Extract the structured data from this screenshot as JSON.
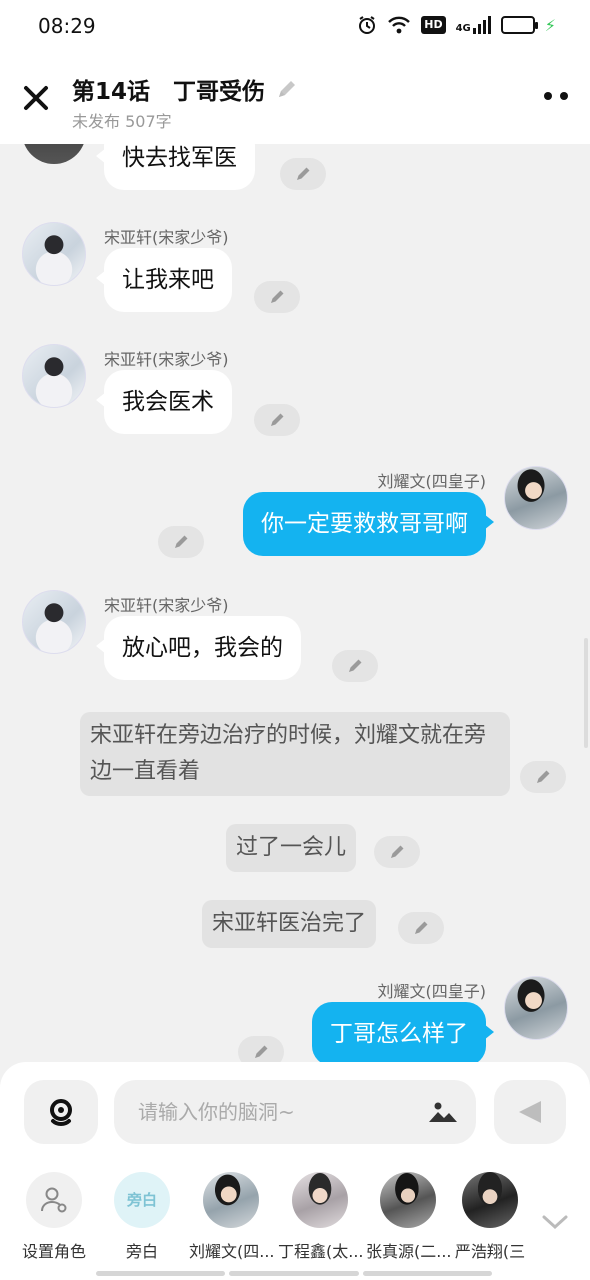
{
  "status_bar": {
    "time": "08:29",
    "network": "4G",
    "hd": "HD",
    "battery_level": 0.9,
    "battery_color": "#35c759"
  },
  "header": {
    "title": "第14话　丁哥受伤",
    "subtitle": "未发布 507字",
    "close_icon": "close-icon",
    "more_icon": "more-icon"
  },
  "messages": [
    {
      "type": "left",
      "sender": "",
      "text": "快去找军医"
    },
    {
      "type": "left",
      "sender": "宋亚轩(宋家少爷)",
      "text": "让我来吧"
    },
    {
      "type": "left",
      "sender": "宋亚轩(宋家少爷)",
      "text": "我会医术"
    },
    {
      "type": "right",
      "sender": "刘耀文(四皇子)",
      "text": "你一定要救救哥哥啊"
    },
    {
      "type": "left",
      "sender": "宋亚轩(宋家少爷)",
      "text": "放心吧，我会的"
    },
    {
      "type": "narration",
      "text": "宋亚轩在旁边治疗的时候，刘耀文就在旁边一直看着"
    },
    {
      "type": "narration",
      "text": "过了一会儿"
    },
    {
      "type": "narration",
      "text": "宋亚轩医治完了"
    },
    {
      "type": "right",
      "sender": "刘耀文(四皇子)",
      "text": "丁哥怎么样了"
    }
  ],
  "input": {
    "placeholder": "请输入你的脑洞~",
    "value": ""
  },
  "roles": [
    {
      "label": "设置角色",
      "kind": "setting"
    },
    {
      "label": "旁白",
      "kind": "narration",
      "avatar_text": "旁白"
    },
    {
      "label": "刘耀文(四...",
      "kind": "character"
    },
    {
      "label": "丁程鑫(太...",
      "kind": "character"
    },
    {
      "label": "张真源(二...",
      "kind": "character"
    },
    {
      "label": "严浩翔(三",
      "kind": "character"
    }
  ],
  "colors": {
    "accent_bubble": "#14b3f0",
    "background": "#f1f1f1",
    "narration_bg": "#e2e2e2"
  }
}
